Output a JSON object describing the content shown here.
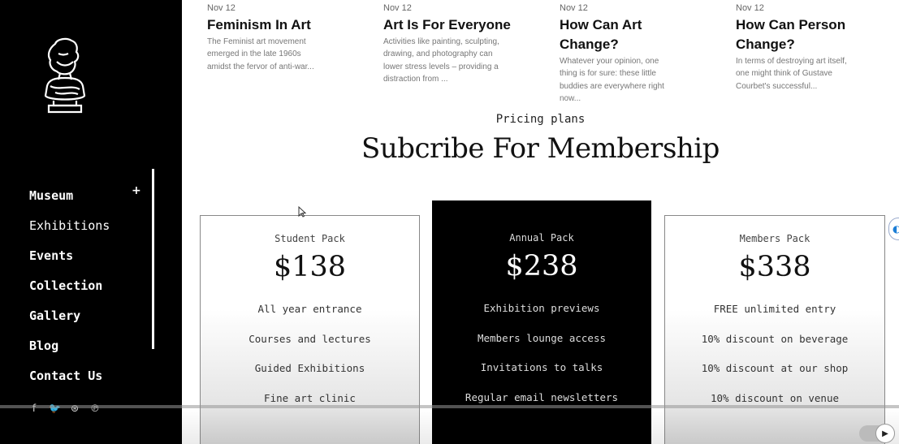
{
  "sidebar": {
    "nav": [
      {
        "label": "Museum",
        "expand": "+"
      },
      {
        "label": "Exhibitions"
      },
      {
        "label": "Events"
      },
      {
        "label": "Collection"
      },
      {
        "label": "Gallery"
      },
      {
        "label": "Blog"
      },
      {
        "label": "Contact Us"
      }
    ],
    "social": [
      "f",
      "🐦",
      "⊛",
      "℗"
    ]
  },
  "blog": [
    {
      "date": "Nov 12",
      "title": "Feminism In Art",
      "excerpt": "The Feminist art movement emerged in the late 1960s amidst the fervor of anti-war..."
    },
    {
      "date": "Nov 12",
      "title": "Art Is For Everyone",
      "excerpt": "Activities like painting, sculpting, drawing, and photography can lower stress levels – providing a distraction from ..."
    },
    {
      "date": "Nov 12",
      "title": "How Can Art Change?",
      "excerpt": "Whatever your opinion, one thing is for sure: these little buddies are everywhere right now..."
    },
    {
      "date": "Nov 12",
      "title": "How Can Person Change?",
      "excerpt": "In terms of destroying art itself, one might think of Gustave Courbet's successful..."
    }
  ],
  "pricing": {
    "eyebrow": "Pricing plans",
    "title": "Subcribe For Membership",
    "plans": [
      {
        "name": "Student Pack",
        "price": "$138",
        "features": [
          "All year entrance",
          "Courses and lectures",
          "Guided Exhibitions",
          "Fine art clinic"
        ]
      },
      {
        "name": "Annual Pack",
        "price": "$238",
        "features": [
          "Exhibition previews",
          "Members lounge access",
          "Invitations to talks",
          "Regular email newsletters"
        ]
      },
      {
        "name": "Members Pack",
        "price": "$338",
        "features": [
          "FREE unlimited entry",
          "10% discount on beverage",
          "10% discount at our shop",
          "10% discount on venue"
        ]
      }
    ]
  },
  "player": {
    "play_icon": "play-icon"
  }
}
